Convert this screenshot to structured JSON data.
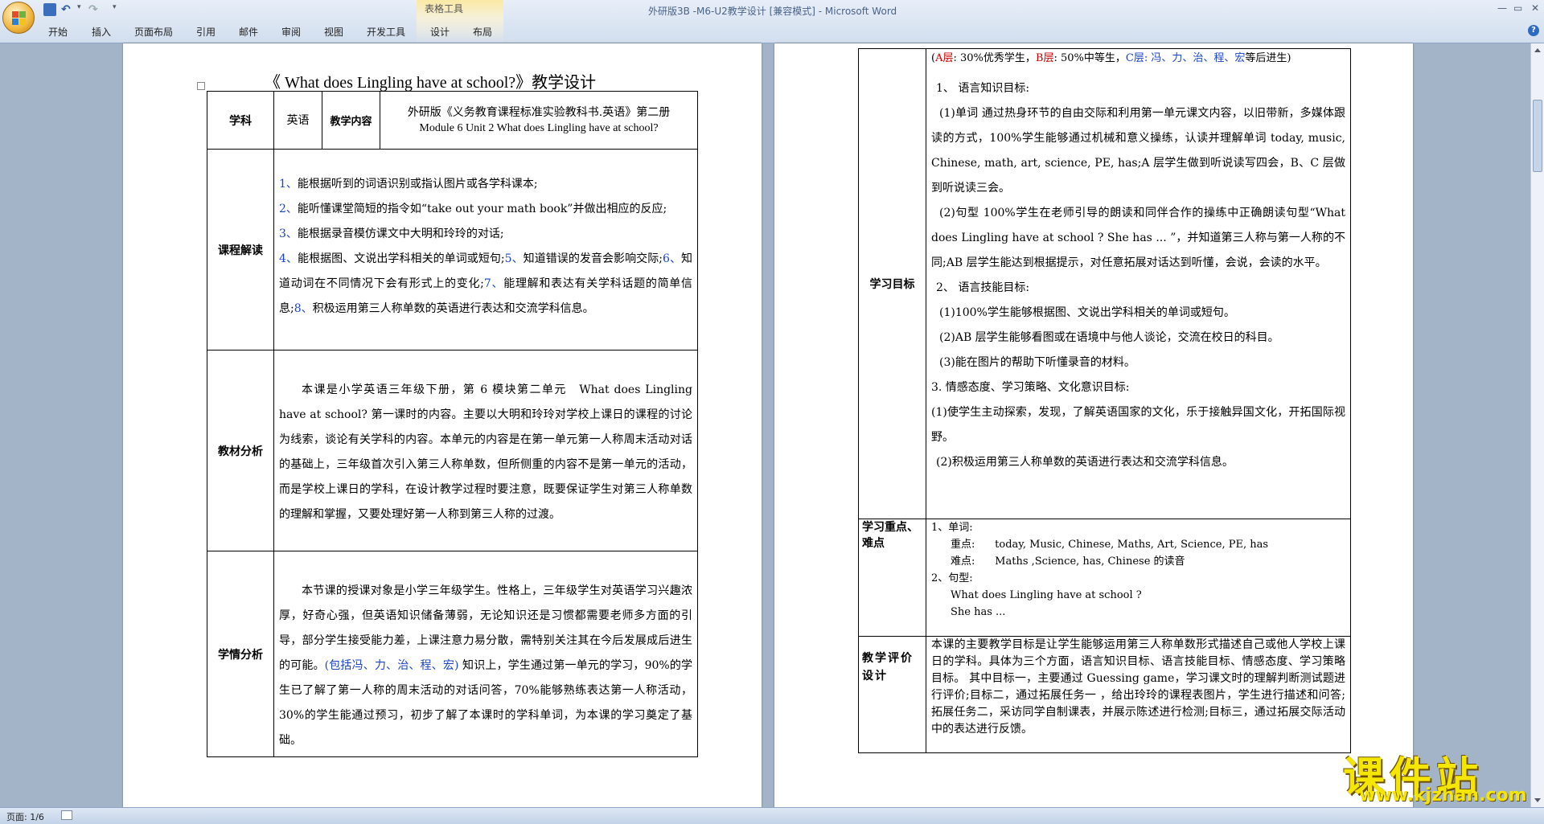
{
  "window": {
    "title": "外研版3B -M6-U2教学设计 [兼容模式] - Microsoft Word",
    "contextual_tab_group": "表格工具",
    "controls": {
      "minimize": "—",
      "maximize": "▭",
      "close": "✕"
    }
  },
  "ribbon": {
    "tabs": [
      "开始",
      "插入",
      "页面布局",
      "引用",
      "邮件",
      "审阅",
      "视图",
      "开发工具",
      "设计",
      "布局"
    ]
  },
  "status_bar": {
    "page_info": "页面: 1/6"
  },
  "page1": {
    "title": "《 What does Lingling have at school?》教学设计",
    "header_row": {
      "subject_label": "学科",
      "subject_value": "英语",
      "content_label": "教学内容",
      "content_line1": "外研版《义务教育课程标准实验教科书.英语》第二册",
      "content_line2": "Module 6 Unit 2 What does Lingling have at school?"
    },
    "course": {
      "label": "课程解读",
      "items": [
        {
          "n": "1、",
          "t": "能根据听到的词语识别或指认图片或各学科课本;"
        },
        {
          "n": "2、",
          "t": "能听懂课堂简短的指令如“take out your math book”并做出相应的反应;"
        },
        {
          "n": "3、",
          "t": "能根据录音模仿课文中大明和玲玲的对话;"
        },
        {
          "n": "4、",
          "t": "能根据图、文说出学科相关的单词或短句;"
        },
        {
          "n": "5、",
          "t": "知道错误的发音会影响交际;"
        },
        {
          "n": "6、",
          "t": "知道动词在不同情况下会有形式上的变化;"
        },
        {
          "n": "7、",
          "t": "能理解和表达有关学科话题的简单信息;"
        },
        {
          "n": "8、",
          "t": "积极运用第三人称单数的英语进行表达和交流学科信息。"
        }
      ]
    },
    "textbook": {
      "label": "教材分析",
      "text": "本课是小学英语三年级下册，第 6 模块第二单元　What does Lingling have at school? 第一课时的内容。主要以大明和玲玲对学校上课日的课程的讨论为线索，谈论有关学科的内容。本单元的内容是在第一单元第一人称周末活动对话的基础上，三年级首次引入第三人称单数，但所侧重的内容不是第一单元的活动，而是学校上课日的学科，在设计教学过程时要注意，既要保证学生对第三人称单数的理解和掌握，又要处理好第一人称到第三人称的过渡。"
    },
    "students": {
      "label": "学情分析",
      "text1": "本节课的授课对象是小学三年级学生。性格上，三年级学生对英语学习兴趣浓厚，好奇心强，但英语知识储备薄弱，无论知识还是习惯都需要老师多方面的引导，部分学生接受能力差，上课注意力易分散，需特别关注其在今后发展成后进生的可能。",
      "text_blue": "(包括冯、力、治、程、宏)",
      "text2": " 知识上，学生通过第一单元的学习，90%的学生已了解了第一人称的周末活动的对话问答，70%能够熟练表达第一人称活动，30%的学生能通过预习，初步了解了本课时的学科单词，为本课的学习奠定了基础。"
    }
  },
  "page2": {
    "goals": {
      "label": "学习目标",
      "levels": {
        "a_label": "A层",
        "a_text": ": 30%优秀学生，",
        "b_label": "B层",
        "b_text": ": 50%中等生，",
        "c_label": "C层",
        "c_text": ": 冯、力、治、程、宏",
        "tail": "等后进生)"
      },
      "lines": [
        "1、  语言知识目标:",
        "(1)单词  通过热身环节的自由交际和利用第一单元课文内容，以旧带新，多媒体跟读的方式，100%学生能够通过机械和意义操练，认读并理解单词 today, music, Chinese, math, art, science, PE, has;A 层学生做到听说读写四会，B、C 层做到听说读三会。",
        "(2)句型  100%学生在老师引导的朗读和同伴合作的操练中正确朗读句型“What does Lingling have at school ?    She has ... ”，并知道第三人称与第一人称的不同;AB 层学生能达到根据提示，对任意拓展对话达到听懂，会说，会读的水平。",
        "2、  语言技能目标:",
        "(1)100%学生能够根据图、文说出学科相关的单词或短句。",
        "(2)AB 层学生能够看图或在语境中与他人谈论，交流在校日的科目。",
        "(3)能在图片的帮助下听懂录音的材料。",
        "3.  情感态度、学习策略、文化意识目标:",
        "(1)使学生主动探索，发现，了解英语国家的文化，乐于接触异国文化，开拓国际视野。",
        "(2)积极运用第三人称单数的英语进行表达和交流学科信息。"
      ]
    },
    "key_points": {
      "label": "学习重点、难点",
      "lines": [
        "1、单词:",
        "重点:      today, Music, Chinese, Maths, Art, Science, PE, has",
        "难点:      Maths ,Science, has, Chinese 的读音",
        "2、句型:",
        "What does Lingling have at school ?",
        "She has ..."
      ]
    },
    "evaluation": {
      "label": "教学评价设计",
      "text": "本课的主要教学目标是让学生能够运用第三人称单数形式描述自己或他人学校上课日的学科。具体为三个方面，语言知识目标、语言技能目标、情感态度、学习策略目标。 其中目标一，主要通过 Guessing game，学习课文时的理解判断测试题进行评价;目标二，通过拓展任务一 ，给出玲玲的课程表图片，学生进行描述和问答;拓展任务二，采访同学自制课表，并展示陈述进行检测;目标三，通过拓展交际活动中的表达进行反馈。"
    }
  },
  "watermark": {
    "line1": "课件站",
    "line2": "www.kjzhan.com"
  },
  "colors": {
    "ribbon": "#d6e2f0",
    "workspace": "#a3b4c9",
    "blue_text": "#1a44c8",
    "red_text": "#c00000",
    "watermark": "#f5e600"
  }
}
